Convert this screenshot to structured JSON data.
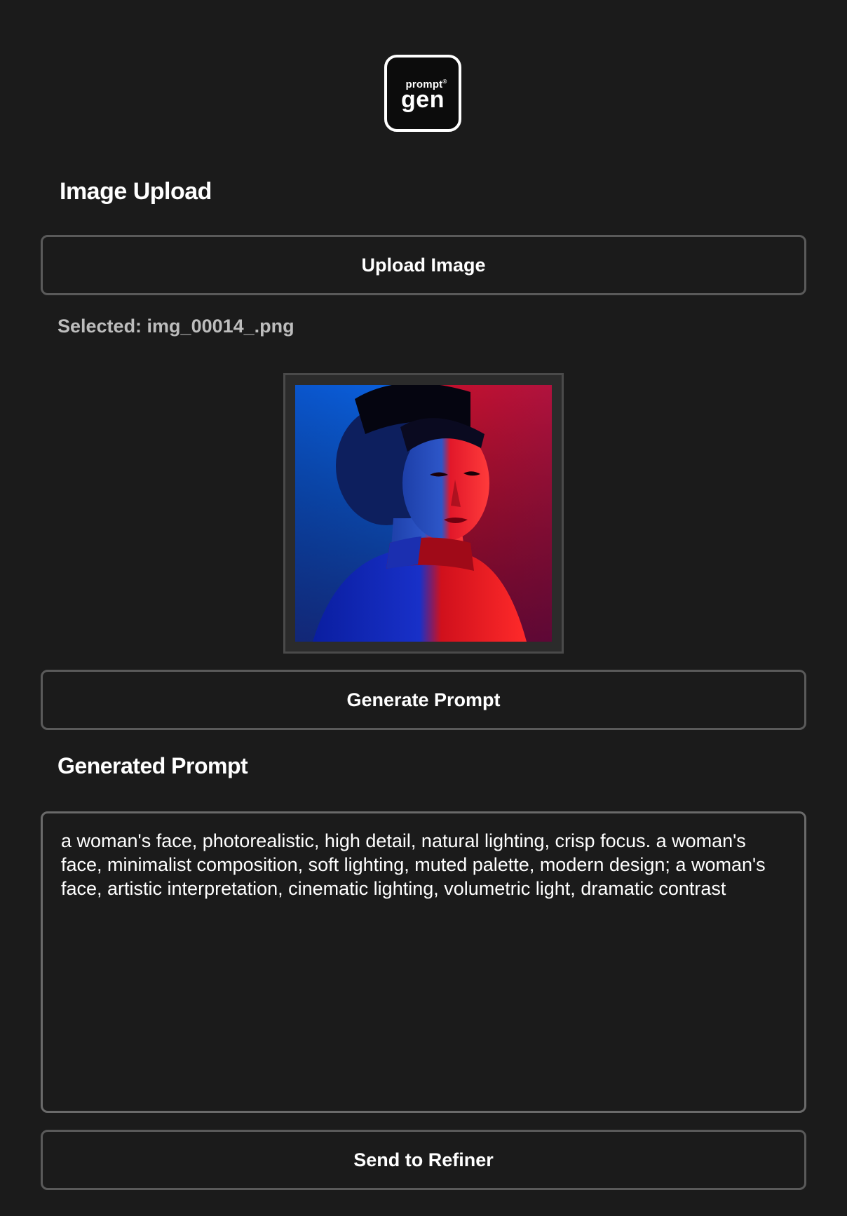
{
  "logo": {
    "top_text": "prompt",
    "mark": "®",
    "main_text": "gen"
  },
  "upload_section": {
    "title": "Image Upload",
    "upload_button_label": "Upload Image",
    "selected_text": "Selected: img_00014_.png",
    "preview_subject": "woman portrait, blue and red lighting"
  },
  "generate_button_label": "Generate Prompt",
  "prompt_section": {
    "title": "Generated Prompt",
    "prompt_text": "a woman's face, photorealistic, high detail, natural lighting, crisp focus. a woman's face, minimalist composition, soft lighting, muted palette, modern design; a woman's face, artistic interpretation, cinematic lighting, volumetric light, dramatic contrast"
  },
  "refiner_button_label": "Send to Refiner",
  "colors": {
    "background": "#1b1b1b",
    "button_border": "#5a5a5a",
    "text": "#ffffff",
    "muted_text": "#bdbdbd",
    "preview_blue": "#0a5bd6",
    "preview_red": "#e0102a"
  }
}
